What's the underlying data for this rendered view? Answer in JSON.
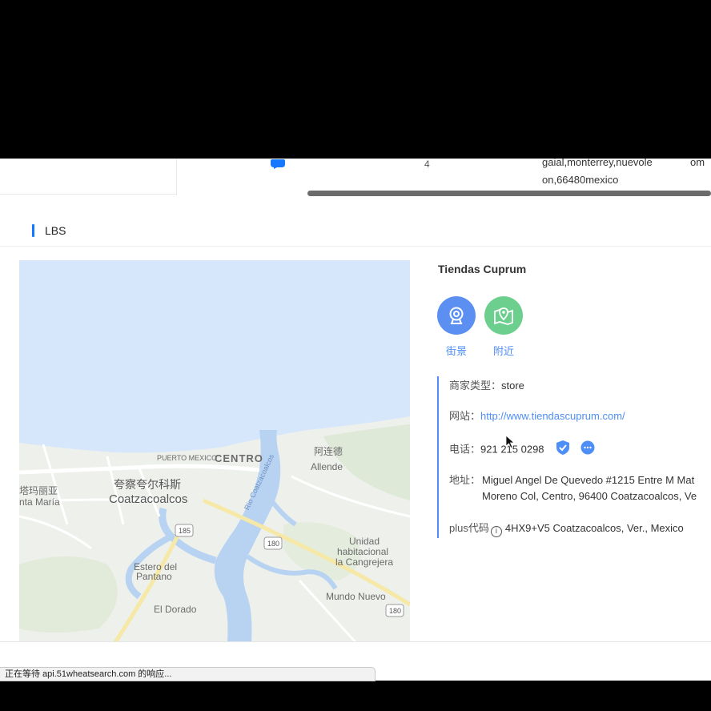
{
  "table_remnant": {
    "count_cell": "4",
    "address_line1": "gaial,monterrey,nuevole",
    "address_line2": "on,66480mexico",
    "truncated_cell": "om"
  },
  "section": {
    "title": "LBS"
  },
  "map": {
    "labels": {
      "puerto_mexico": "PUERTO MEXICO",
      "centro": "CENTRO",
      "allende_cn": "阿连德",
      "allende": "Allende",
      "coatza_cn": "夸察夸尔科斯",
      "coatza": "Coatzacoalcos",
      "santa_maria_cn": "塔玛丽亚",
      "santa_maria": "nta María",
      "hwy_185": "185",
      "hwy_180a": "180",
      "hwy_180b": "180",
      "unidad1": "Unidad",
      "unidad2": "habitacional",
      "unidad3": "la Cangrejera",
      "estero1": "Estero del",
      "estero2": "Pantano",
      "el_dorado": "El Dorado",
      "mundo_nuevo": "Mundo Nuevo",
      "river": "Río Coatzacoalcos"
    }
  },
  "store": {
    "name": "Tiendas Cuprum",
    "actions": {
      "street_view": "街景",
      "nearby": "附近"
    },
    "type_label": "商家类型：",
    "type_value": "store",
    "website_label": "网站：",
    "website_value": "http://www.tiendascuprum.com/",
    "phone_label": "电话：",
    "phone_value": "921 215 0298",
    "address_label": "地址：",
    "address_line1": "Miguel Angel De Quevedo #1215 Entre M Mat",
    "address_line2": "Moreno Col, Centro, 96400 Coatzacoalcos, Ve",
    "plus_label": "plus代码",
    "plus_value": "4HX9+V5 Coatzacoalcos, Ver., Mexico"
  },
  "status_bar": {
    "text": "正在等待 api.51wheatsearch.com 的响应..."
  },
  "colors": {
    "accent": "#4e8ef7",
    "street_view": "#5b8ff2",
    "nearby": "#6ccf8e",
    "water": "#d6e6fb"
  }
}
